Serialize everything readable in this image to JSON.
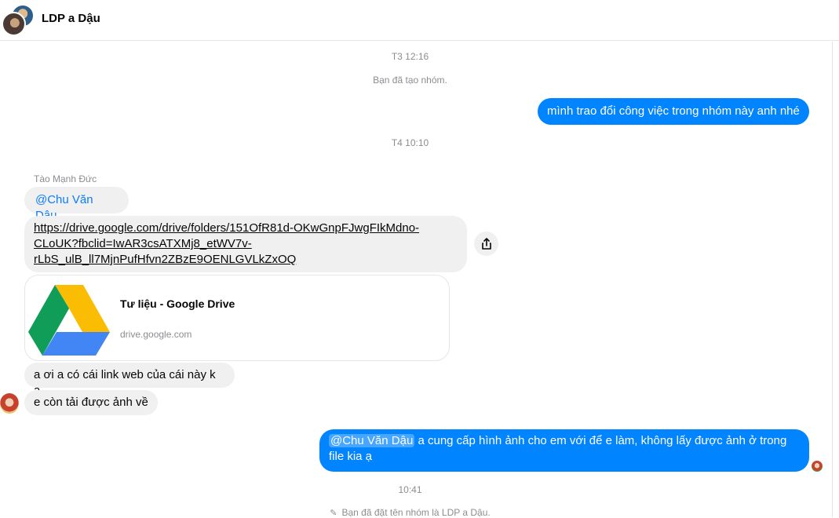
{
  "header": {
    "title": "LDP a Dậu"
  },
  "messages": {
    "ts1": "T3 12:16",
    "sys_created": "Bạn đã tạo nhóm.",
    "out1": "mình trao đổi công việc trong nhóm này anh nhé",
    "ts2": "T4 10:10",
    "sender": "Tào Mạnh Đức",
    "mention1": "@Chu Văn Dậu",
    "link": "https://drive.google.com/drive/folders/151OfR81d-OKwGnpFJwgFIkMdno-CLoUK?fbclid=IwAR3csATXMj8_etWV7v-rLbS_ulB_ll7MjnPufHfvn2ZBzE9OENLGVLkZxOQ",
    "link_line1": "https://drive.google.com/drive/folders/151OfR81d-OKwGnpFJwgFIkMdno-",
    "link_line2": "CLoUK?fbclid=IwAR3csATXMj8_etWV7v-",
    "link_line3": "rLbS_ulB_ll7MjnPufHfvn2ZBzE9OENLGVLkZxOQ",
    "card_title": "Tư liệu - Google Drive",
    "card_domain": "drive.google.com",
    "in2": "a ơi a có cái link web của cái này k ạ",
    "in3": "e còn tải được ảnh về",
    "out2_mention": "@Chu Văn Dậu",
    "out2_line1": " a cung cấp hình ảnh cho em với để e làm, không lấy được ảnh ở trong",
    "out2_line2": "file kia ạ",
    "ts3": "10:41",
    "sys_renamed": "Bạn đã đặt tên nhóm là LDP a Dậu."
  },
  "icons": {
    "share": "share-icon",
    "drive": "google-drive-icon",
    "pencil": "pencil-icon"
  },
  "colors": {
    "outgoing": "#0084ff",
    "incoming": "#f0f0f0",
    "mention": "#0a7cff"
  }
}
